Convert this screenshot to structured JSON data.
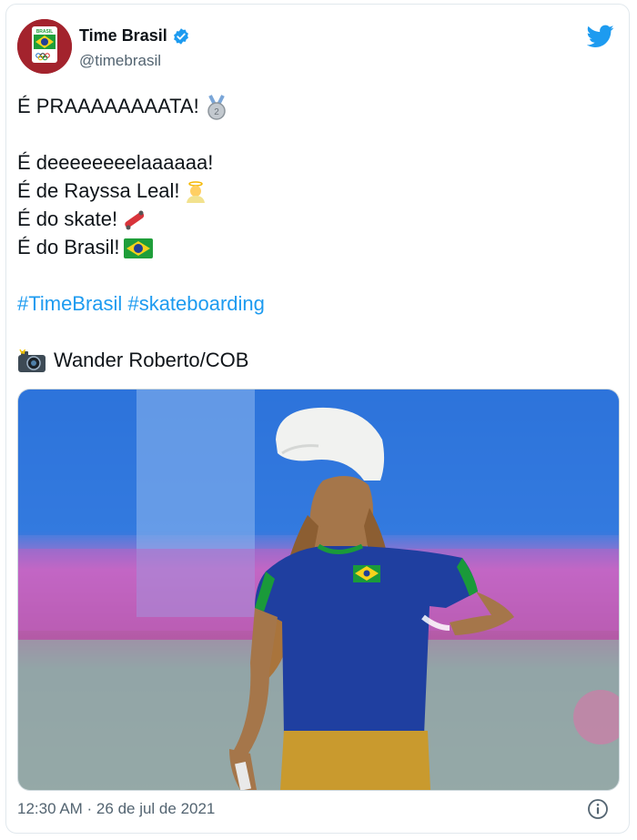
{
  "tweet": {
    "author_name": "Time Brasil",
    "handle": "@timebrasil",
    "lines": [
      "É PRAAAAAAAATA!",
      "",
      "É deeeeeeeelaaaaaa!",
      "É de Rayssa Leal!",
      "É do skate!",
      "É do Brasil!",
      "",
      "#TimeBrasil #skateboarding",
      "",
      "Wander Roberto/COB"
    ],
    "hashtags": [
      "#TimeBrasil",
      "#skateboarding"
    ],
    "timestamp": "12:30 AM · 26 de jul de 2021",
    "avatar_text": "BRASIL"
  },
  "icons": {
    "logo": "twitter-bird-icon",
    "verified": "verified-badge-icon",
    "info": "info-icon"
  },
  "colors": {
    "link": "#1d9bf0",
    "verified": "#1d9bf0",
    "secondary_text": "#536471",
    "jersey": "#1f3fa0",
    "shorts": "#c99a2e"
  }
}
